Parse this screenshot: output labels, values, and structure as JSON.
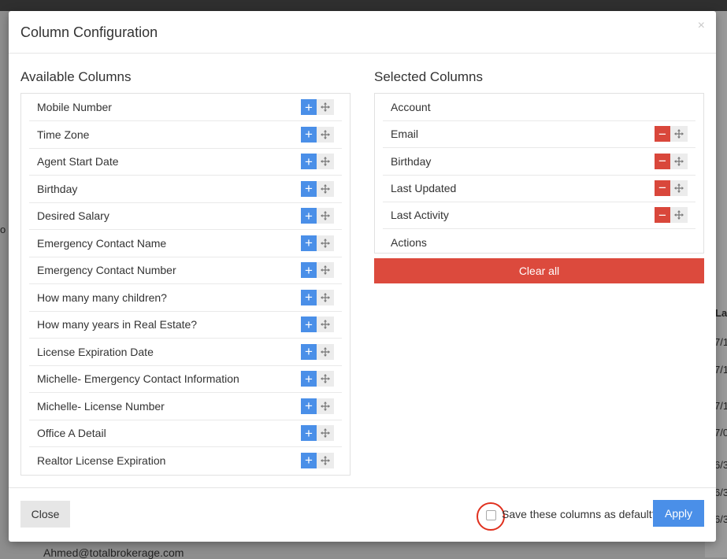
{
  "background": {
    "email_text": "Ahmed@totalbrokerage.com",
    "col_header": "La",
    "dates": [
      "7/1",
      "7/1",
      "7/1",
      "7/0",
      "6/3",
      "6/3",
      "6/3"
    ],
    "left_fragment": "o"
  },
  "modal": {
    "title": "Column Configuration",
    "close_glyph": "×",
    "available": {
      "title": "Available Columns",
      "items": [
        "Mobile Number",
        "Time Zone",
        "Agent Start Date",
        "Birthday",
        "Desired Salary",
        "Emergency Contact Name",
        "Emergency Contact Number",
        "How many many children?",
        "How many years in Real Estate?",
        "License Expiration Date",
        "Michelle- Emergency Contact Information",
        "Michelle- License Number",
        "Office A Detail",
        "Realtor License Expiration"
      ]
    },
    "selected": {
      "title": "Selected Columns",
      "items": [
        "Account",
        "Email",
        "Birthday",
        "Last Updated",
        "Last Activity",
        "Actions"
      ],
      "removable": [
        false,
        true,
        true,
        true,
        true,
        false
      ]
    },
    "clear_all": "Clear all",
    "footer": {
      "close": "Close",
      "save_default_label": "Save these columns as default?",
      "apply": "Apply"
    },
    "icons": {
      "add": "plus-icon",
      "remove": "minus-icon",
      "move": "move-icon"
    },
    "colors": {
      "add": "#4a8fe8",
      "remove": "#d9473b",
      "clear": "#dc4a3d",
      "highlight": "#e0301e"
    }
  }
}
